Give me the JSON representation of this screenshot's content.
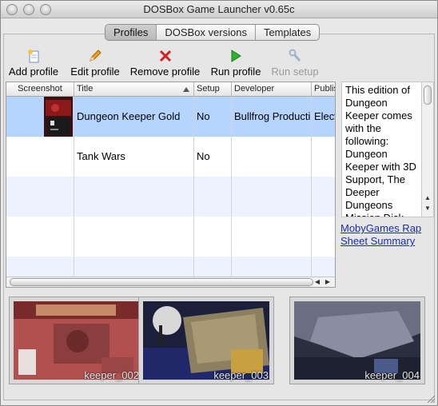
{
  "window": {
    "title": "DOSBox Game Launcher v0.65c"
  },
  "tabs": [
    {
      "label": "Profiles",
      "active": true
    },
    {
      "label": "DOSBox versions",
      "active": false
    },
    {
      "label": "Templates",
      "active": false
    }
  ],
  "toolbar": {
    "add_label": "Add profile",
    "edit_label": "Edit profile",
    "remove_label": "Remove profile",
    "run_label": "Run profile",
    "setup_label": "Run setup"
  },
  "table": {
    "columns": [
      "Screenshot",
      "Title",
      "Setup",
      "Developer",
      "Publis"
    ],
    "rows": [
      {
        "title": "Dungeon Keeper Gold",
        "setup": "No",
        "developer": "Bullfrog Productio",
        "publisher": "Elect"
      },
      {
        "title": "Tank Wars",
        "setup": "No",
        "developer": "",
        "publisher": ""
      }
    ]
  },
  "description": {
    "text": "This edition of Dungeon Keeper comes with the following: Dungeon Keeper with 3D Support, The Deeper Dungeons Mission Disk"
  },
  "link": {
    "label": "MobyGames Rap Sheet Summary"
  },
  "screenshots": [
    {
      "label": "keeper_002"
    },
    {
      "label": "keeper_003"
    },
    {
      "label": "keeper_004"
    }
  ],
  "colors": {
    "selection": "#b5d5ff",
    "link": "#1a2bb8",
    "run_icon": "#2fb12f",
    "remove_icon": "#d02020"
  }
}
